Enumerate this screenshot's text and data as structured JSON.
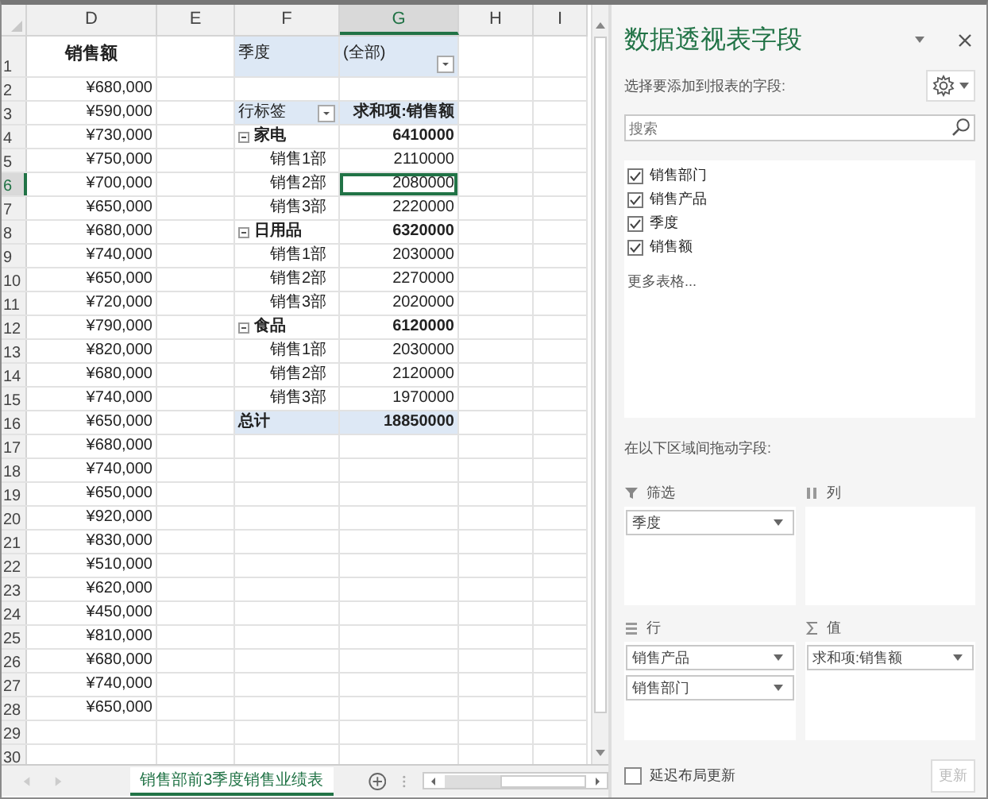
{
  "sheet": {
    "columns": [
      {
        "label": "D",
        "selected": false
      },
      {
        "label": "E",
        "selected": false
      },
      {
        "label": "F",
        "selected": false
      },
      {
        "label": "G",
        "selected": true
      },
      {
        "label": "H",
        "selected": false
      },
      {
        "label": "I",
        "selected": false
      }
    ],
    "rows": [
      {
        "number": "1",
        "selected": false,
        "d": "销售额",
        "pivot": {
          "kind": "filter",
          "label": "季度",
          "value": "(全部)"
        }
      },
      {
        "number": "2",
        "selected": false,
        "d": "¥680,000"
      },
      {
        "number": "3",
        "selected": false,
        "d": "¥590,000",
        "pivot": {
          "kind": "header",
          "label": "行标签",
          "value": "求和项:销售额"
        }
      },
      {
        "number": "4",
        "selected": false,
        "d": "¥730,000",
        "pivot": {
          "kind": "group",
          "label": "家电",
          "value": "6410000"
        }
      },
      {
        "number": "5",
        "selected": false,
        "d": "¥750,000",
        "pivot": {
          "kind": "item",
          "label": "销售1部",
          "value": "2110000"
        }
      },
      {
        "number": "6",
        "selected": true,
        "d": "¥700,000",
        "pivot": {
          "kind": "item",
          "label": "销售2部",
          "value": "2080000"
        }
      },
      {
        "number": "7",
        "selected": false,
        "d": "¥650,000",
        "pivot": {
          "kind": "item",
          "label": "销售3部",
          "value": "2220000"
        }
      },
      {
        "number": "8",
        "selected": false,
        "d": "¥680,000",
        "pivot": {
          "kind": "group",
          "label": "日用品",
          "value": "6320000"
        }
      },
      {
        "number": "9",
        "selected": false,
        "d": "¥740,000",
        "pivot": {
          "kind": "item",
          "label": "销售1部",
          "value": "2030000"
        }
      },
      {
        "number": "10",
        "selected": false,
        "d": "¥650,000",
        "pivot": {
          "kind": "item",
          "label": "销售2部",
          "value": "2270000"
        }
      },
      {
        "number": "11",
        "selected": false,
        "d": "¥720,000",
        "pivot": {
          "kind": "item",
          "label": "销售3部",
          "value": "2020000"
        }
      },
      {
        "number": "12",
        "selected": false,
        "d": "¥790,000",
        "pivot": {
          "kind": "group",
          "label": "食品",
          "value": "6120000"
        }
      },
      {
        "number": "13",
        "selected": false,
        "d": "¥820,000",
        "pivot": {
          "kind": "item",
          "label": "销售1部",
          "value": "2030000"
        }
      },
      {
        "number": "14",
        "selected": false,
        "d": "¥680,000",
        "pivot": {
          "kind": "item",
          "label": "销售2部",
          "value": "2120000"
        }
      },
      {
        "number": "15",
        "selected": false,
        "d": "¥740,000",
        "pivot": {
          "kind": "item",
          "label": "销售3部",
          "value": "1970000"
        }
      },
      {
        "number": "16",
        "selected": false,
        "d": "¥650,000",
        "pivot": {
          "kind": "total",
          "label": "总计",
          "value": "18850000"
        }
      },
      {
        "number": "17",
        "selected": false,
        "d": "¥680,000"
      },
      {
        "number": "18",
        "selected": false,
        "d": "¥740,000"
      },
      {
        "number": "19",
        "selected": false,
        "d": "¥650,000"
      },
      {
        "number": "20",
        "selected": false,
        "d": "¥920,000"
      },
      {
        "number": "21",
        "selected": false,
        "d": "¥830,000"
      },
      {
        "number": "22",
        "selected": false,
        "d": "¥510,000"
      },
      {
        "number": "23",
        "selected": false,
        "d": "¥620,000"
      },
      {
        "number": "24",
        "selected": false,
        "d": "¥450,000"
      },
      {
        "number": "25",
        "selected": false,
        "d": "¥810,000"
      },
      {
        "number": "26",
        "selected": false,
        "d": "¥680,000"
      },
      {
        "number": "27",
        "selected": false,
        "d": "¥740,000"
      },
      {
        "number": "28",
        "selected": false,
        "d": "¥650,000"
      },
      {
        "number": "29",
        "selected": false
      },
      {
        "number": "30",
        "selected": false
      }
    ],
    "tab": {
      "label": "销售部前3季度销售业绩表",
      "selected": true
    }
  },
  "pane": {
    "title": "数据透视表字段",
    "subtitle": "选择要添加到报表的字段:",
    "search": {
      "placeholder": "搜索"
    },
    "fields": [
      {
        "label": "销售部门",
        "checked": true
      },
      {
        "label": "销售产品",
        "checked": true
      },
      {
        "label": "季度",
        "checked": true
      },
      {
        "label": "销售额",
        "checked": true
      }
    ],
    "more_tables": "更多表格...",
    "areas_label": "在以下区域间拖动字段:",
    "areas": [
      {
        "kind": "filter",
        "label": "筛选",
        "items": [
          "季度"
        ]
      },
      {
        "kind": "columns",
        "label": "列"
      },
      {
        "kind": "rows",
        "label": "行",
        "items": [
          "销售产品",
          "销售部门"
        ]
      },
      {
        "kind": "values",
        "label": "值",
        "items": [
          "求和项:销售额"
        ]
      }
    ],
    "defer": {
      "label": "延迟布局更新",
      "checked": false
    },
    "update_button": {
      "label": "更新",
      "disabled": true
    }
  }
}
